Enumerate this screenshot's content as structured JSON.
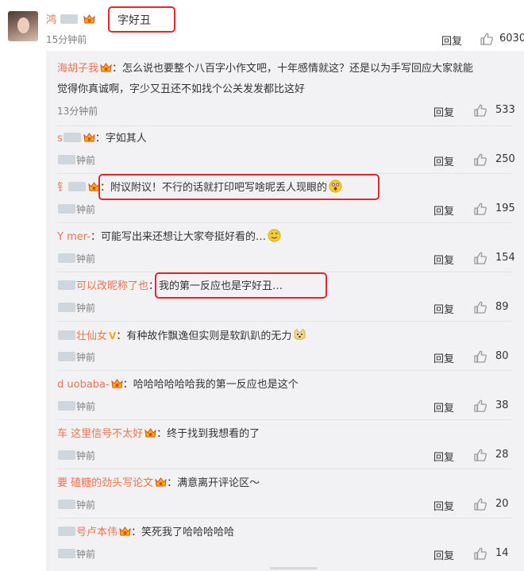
{
  "main_comment": {
    "username": "鸿",
    "text": "字好丑",
    "time": "15分钟前",
    "reply": "回复",
    "likes": "6030"
  },
  "replies": [
    {
      "username": "海胡子我",
      "lines": [
        "：怎么说也要整个八百字小作文吧，十年感情就这？还是以为手写回应大家就能",
        "觉得你真诚啊，字少又丑还不如找个公关发发都比这好"
      ],
      "time": "13分钟前",
      "reply": "回复",
      "likes": "533"
    },
    {
      "username": "s",
      "lines": [
        "：字如其人"
      ],
      "time": "钟前",
      "reply": "回复",
      "likes": "250"
    },
    {
      "username": "钅",
      "lines": [
        "：附议附议！不行的话就打印吧写啥呢丢人现眼的"
      ],
      "time": "钟前",
      "reply": "回复",
      "likes": "195"
    },
    {
      "username": "Y mer-",
      "lines": [
        "：可能写出来还想让大家夸挺好看的…"
      ],
      "time": "钟前",
      "reply": "回复",
      "likes": "154"
    },
    {
      "username": "可以改昵称了也",
      "lines": [
        "：我的第一反应也是字好丑…"
      ],
      "time": "钟前",
      "reply": "回复",
      "likes": "89"
    },
    {
      "username": "壮仙女",
      "lines": [
        "：有种故作飘逸但实则是软趴趴的无力"
      ],
      "time": "钟前",
      "reply": "回复",
      "likes": "80"
    },
    {
      "username": "d uobaba-",
      "lines": [
        "：哈哈哈哈哈哈我的第一反应也是这个"
      ],
      "time": "钟前",
      "reply": "回复",
      "likes": "38"
    },
    {
      "username": "车 这里信号不太好",
      "lines": [
        "：终于找到我想看的了"
      ],
      "time": "钟前",
      "reply": "回复",
      "likes": "28"
    },
    {
      "username": "要 磕糖的劲头写论文",
      "lines": [
        "：满意离开评论区～"
      ],
      "time": "钟前",
      "reply": "回复",
      "likes": "20"
    },
    {
      "username": "号卢本伟",
      "lines": [
        "：笑死我了哈哈哈哈哈"
      ],
      "time": "钟前",
      "reply": "回复",
      "likes": "14"
    }
  ],
  "colors": {
    "username": "#eb7350",
    "highlight": "#e4262f",
    "reply_bg": "#f2f2f5",
    "meta": "#808080"
  },
  "icons": {
    "like": "thumbs-up-icon",
    "badge": "vip-crown-icon"
  }
}
